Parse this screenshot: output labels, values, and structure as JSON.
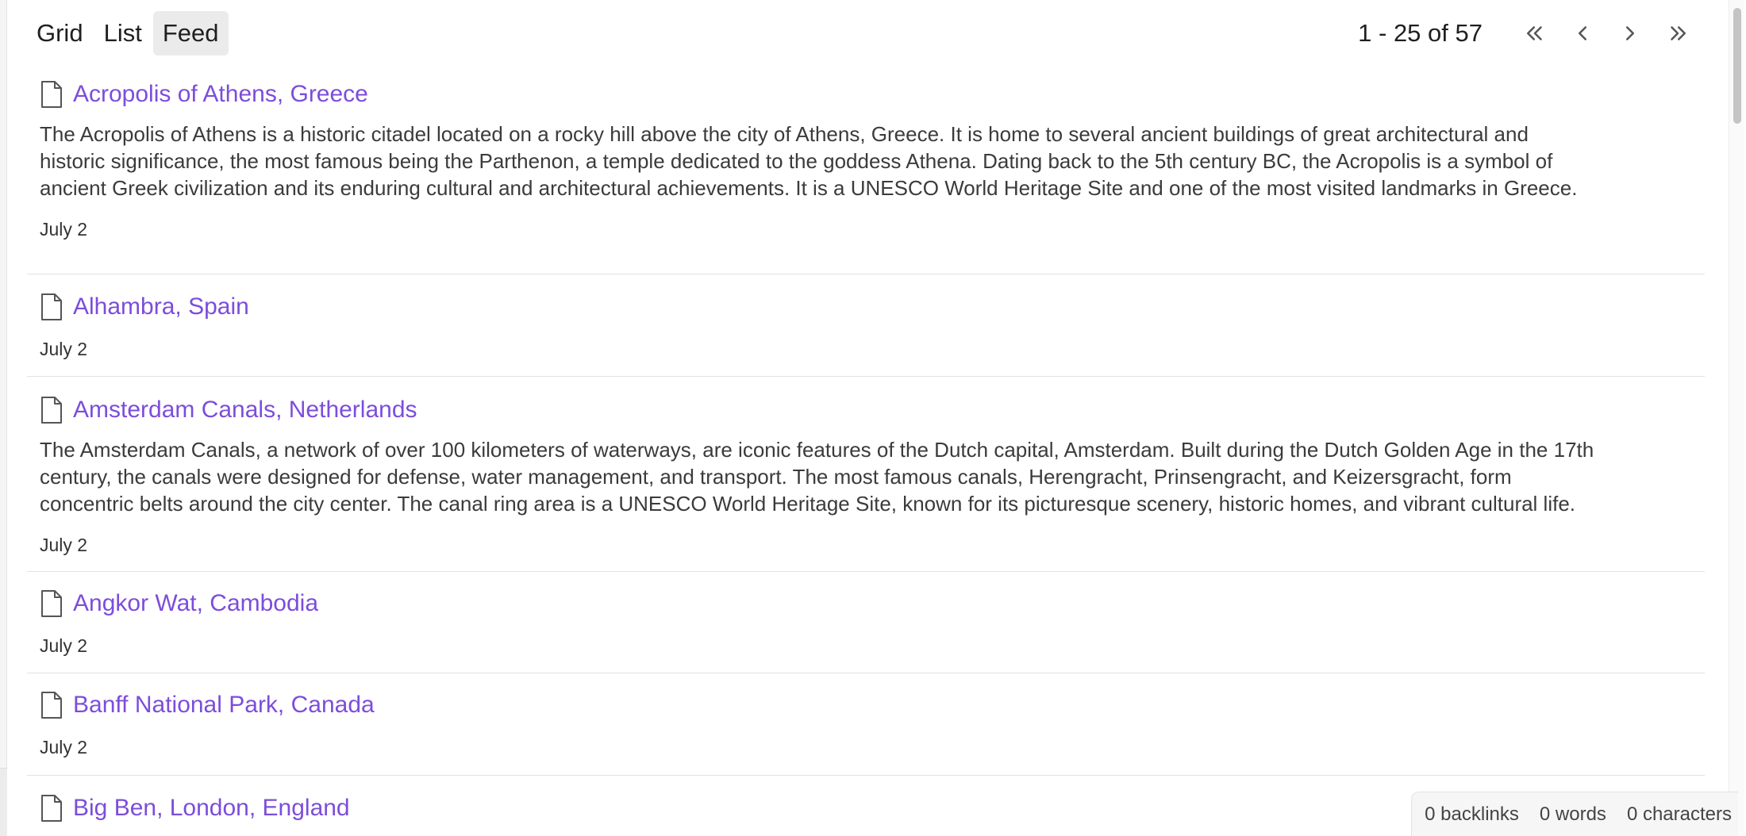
{
  "toolbar": {
    "views": [
      {
        "label": "Grid",
        "active": false
      },
      {
        "label": "List",
        "active": false
      },
      {
        "label": "Feed",
        "active": true
      }
    ],
    "pager": {
      "range_text": "1 - 25 of 57",
      "first_icon": "double-chevron-left-icon",
      "prev_icon": "chevron-left-icon",
      "next_icon": "chevron-right-icon",
      "last_icon": "double-chevron-right-icon"
    }
  },
  "feed": {
    "items": [
      {
        "title": "Acropolis of Athens, Greece",
        "icon": "document-icon",
        "summary_lines": [
          "The Acropolis of Athens is a historic citadel located on a rocky hill above the city of Athens, Greece. It is home to several ancient buildings of great architectural and",
          "historic significance, the most famous being the Parthenon, a temple dedicated to the goddess Athena. Dating back to the 5th century BC, the Acropolis is a symbol of",
          "ancient Greek civilization and its enduring cultural and architectural achievements. It is a UNESCO World Heritage Site and one of the most visited landmarks in Greece."
        ],
        "date": "July 2"
      },
      {
        "title": "Alhambra, Spain",
        "icon": "document-icon",
        "summary_lines": [],
        "date": "July 2"
      },
      {
        "title": "Amsterdam Canals, Netherlands",
        "icon": "document-icon",
        "summary_lines": [
          "The Amsterdam Canals, a network of over 100 kilometers of waterways, are iconic features of the Dutch capital, Amsterdam. Built during the Dutch Golden Age in the 17th",
          "century, the canals were designed for defense, water management, and transport. The most famous canals, Herengracht, Prinsengracht, and Keizersgracht, form",
          "concentric belts around the city center. The canal ring area is a UNESCO World Heritage Site, known for its picturesque scenery, historic homes, and vibrant cultural life."
        ],
        "date": "July 2"
      },
      {
        "title": "Angkor Wat, Cambodia",
        "icon": "document-icon",
        "summary_lines": [],
        "date": "July 2"
      },
      {
        "title": "Banff National Park, Canada",
        "icon": "document-icon",
        "summary_lines": [],
        "date": "July 2"
      },
      {
        "title": "Big Ben, London, England",
        "icon": "document-icon",
        "summary_lines": [],
        "date": ""
      }
    ]
  },
  "status_bar": {
    "backlinks": "0 backlinks",
    "words": "0 words",
    "characters": "0 characters"
  },
  "colors": {
    "link": "#7c4ddb",
    "active_tab_bg": "#ebebeb",
    "divider": "#e2e2e2"
  }
}
